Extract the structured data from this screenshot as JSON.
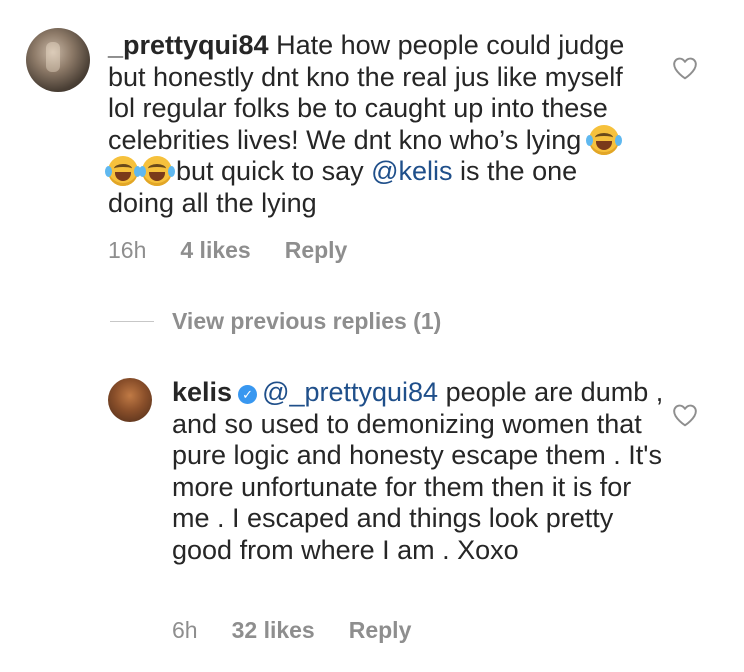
{
  "comments": [
    {
      "username": "_prettyqui84",
      "text_before_emoji": " Hate how people could judge but honestly dnt kno the real jus like myself lol regular folks be to caught up into these celebrities lives! We dnt kno who’s lying ",
      "emoji_icon": "face-with-tears-of-joy-emoji",
      "emoji_count": 3,
      "text_after_emoji": "but quick to say ",
      "mention": "@kelis",
      "text_end": " is the one doing all the lying",
      "time": "16h",
      "likes": "4 likes",
      "reply_label": "Reply"
    }
  ],
  "view_replies_label": "View previous replies (1)",
  "reply": {
    "username": "kelis",
    "verified_icon": "verified-badge-icon",
    "mention": "@_prettyqui84",
    "text": " people are dumb , and so used to demonizing women that pure logic and honesty escape them . It's more unfortunate for them then it is for me . I escaped and things look pretty good from where I am . Xoxo",
    "time": "6h",
    "likes": "32 likes",
    "reply_label": "Reply"
  },
  "colors": {
    "text": "#262626",
    "muted": "#8e8e8e",
    "mention": "#1f4f8a",
    "verified": "#3897f0"
  }
}
